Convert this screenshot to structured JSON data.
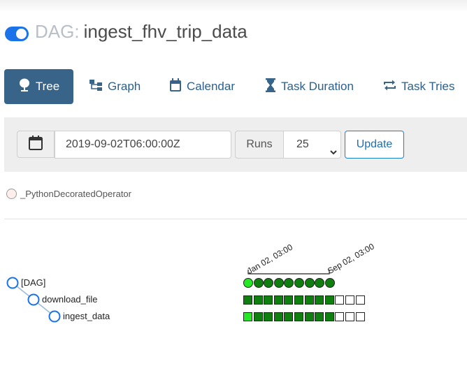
{
  "header": {
    "toggle_on": true,
    "prefix": "DAG:",
    "dag_id": "ingest_fhv_trip_data"
  },
  "tabs": [
    {
      "label": "Tree",
      "icon": "tree-icon",
      "active": true
    },
    {
      "label": "Graph",
      "icon": "graph-icon",
      "active": false
    },
    {
      "label": "Calendar",
      "icon": "calendar-icon",
      "active": false
    },
    {
      "label": "Task Duration",
      "icon": "hourglass-icon",
      "active": false
    },
    {
      "label": "Task Tries",
      "icon": "retry-icon",
      "active": false
    }
  ],
  "controls": {
    "base_date": "2019-09-02T06:00:00Z",
    "runs_label": "Runs",
    "runs_value": "25",
    "update_label": "Update"
  },
  "legend": {
    "operator": "_PythonDecoratedOperator",
    "color": "#ffefeb"
  },
  "tree": {
    "nodes": [
      "[DAG]",
      "download_file",
      "ingest_data"
    ],
    "date_start": "Jan 02, 03:00",
    "date_end": "Sep 02, 03:00",
    "dag_runs": 9,
    "task_rows": [
      {
        "filled": 9,
        "empty": 3,
        "first_running": true
      },
      {
        "filled": 9,
        "empty": 3,
        "first_running": false
      }
    ],
    "colors": {
      "success": "#0f7f0f",
      "running": "#23e823",
      "tree_line": "#1a73e8"
    }
  }
}
